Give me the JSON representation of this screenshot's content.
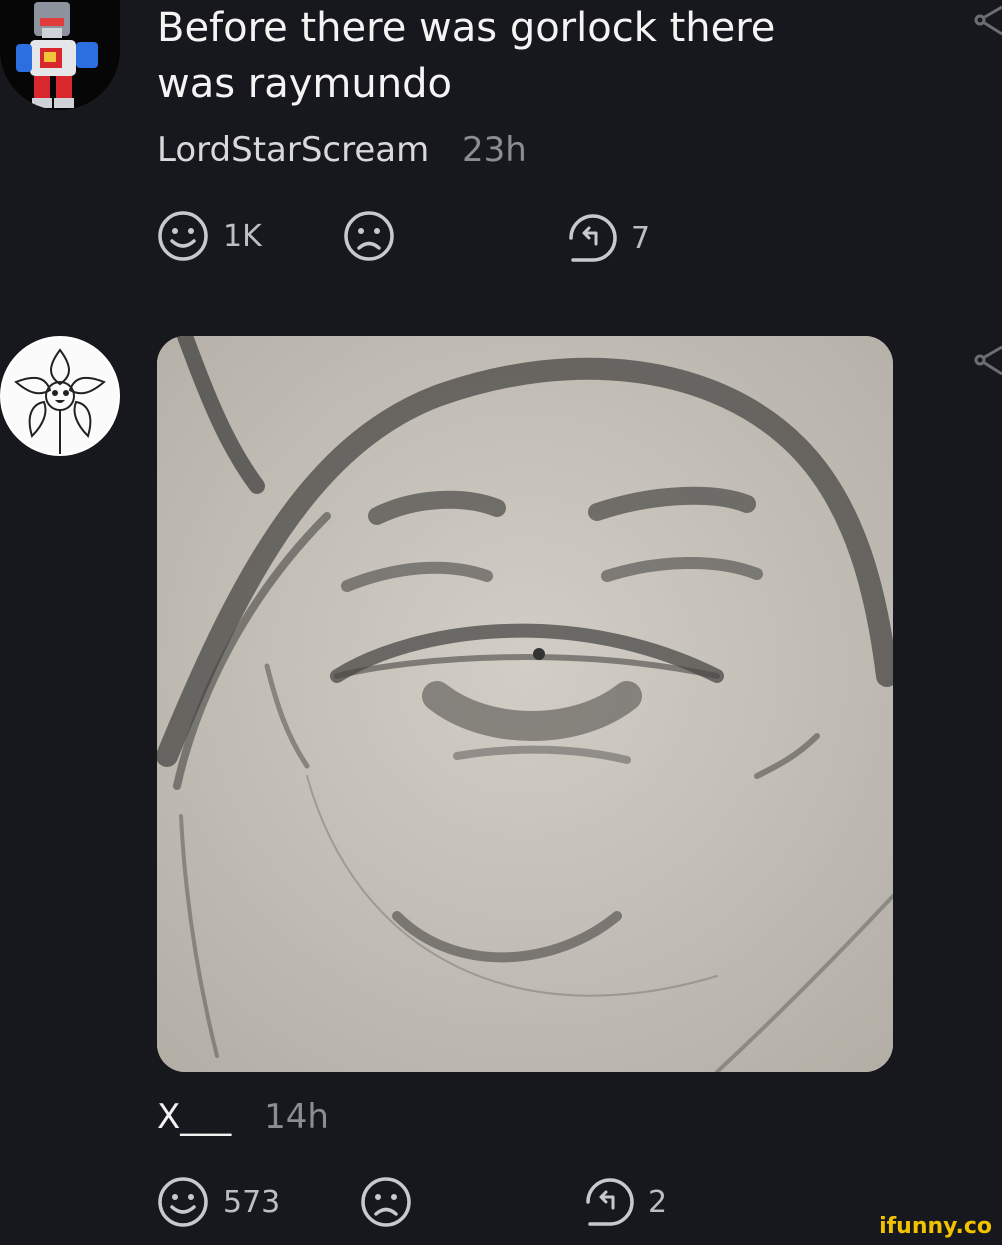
{
  "comment1": {
    "text": "Before there was gorlock there was raymundo",
    "username": "LordStarScream",
    "time": "23h",
    "smile_count": "1K",
    "reply_count": "7"
  },
  "comment2": {
    "username": "X___",
    "time": "14h",
    "smile_count": "573",
    "reply_count": "2"
  },
  "watermark": "ifunny.co",
  "colors": {
    "background": "#17181d",
    "text": "#f4f4f4",
    "muted": "#8b8d92",
    "icon": "#c8c9cc",
    "watermark": "#f2c200"
  },
  "icons": [
    "robot-avatar-icon",
    "smile-icon",
    "frown-icon",
    "reply-icon",
    "share-icon",
    "flower-avatar-icon"
  ]
}
